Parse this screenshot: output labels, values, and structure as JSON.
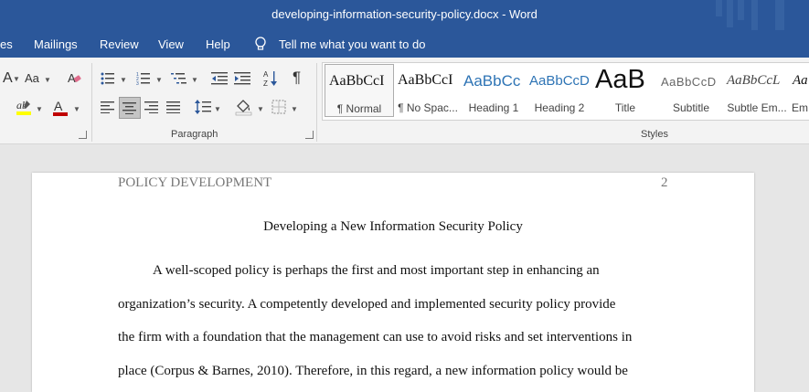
{
  "window": {
    "title": "developing-information-security-policy.docx  -  Word"
  },
  "menu": {
    "items": [
      "es",
      "Mailings",
      "Review",
      "View",
      "Help"
    ],
    "tell_me": "Tell me what you want to do"
  },
  "ribbon": {
    "font": {
      "case_label": "Aa"
    },
    "paragraph_label": "Paragraph",
    "styles_label": "Styles",
    "styles": [
      {
        "sample": "AaBbCcI",
        "name": "¶ Normal"
      },
      {
        "sample": "AaBbCcI",
        "name": "¶ No Spac..."
      },
      {
        "sample": "AaBbCc",
        "name": "Heading 1"
      },
      {
        "sample": "AaBbCcD",
        "name": "Heading 2"
      },
      {
        "sample": "AaB",
        "name": "Title"
      },
      {
        "sample": "AaBbCcD",
        "name": "Subtitle"
      },
      {
        "sample": "AaBbCcL",
        "name": "Subtle Em..."
      },
      {
        "sample": "Aa",
        "name": "Em"
      }
    ]
  },
  "document": {
    "header_left": "POLICY DEVELOPMENT",
    "page_number": "2",
    "title": "Developing a New Information Security Policy",
    "lines": [
      "A well-scoped policy is perhaps the first and most important step in enhancing an",
      "organization’s security. A competently developed and implemented security policy provide",
      "the firm with a foundation that the management can use to avoid risks and set interventions in",
      "place (Corpus & Barnes, 2010). Therefore, in this regard, a new information policy would be"
    ]
  },
  "colors": {
    "titlebar": "#2b579a",
    "font_color_red": "#c00000",
    "highlight_yellow": "#ffff00"
  }
}
